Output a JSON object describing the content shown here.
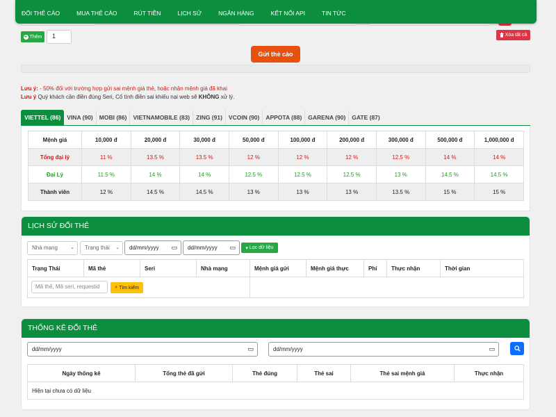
{
  "nav": {
    "items": [
      "ĐỔI THẺ CÀO",
      "MUA THẺ CÀO",
      "RÚT TIỀN",
      "LỊCH SỬ",
      "NGÂN HÀNG",
      "KẾT NỐI API",
      "TIN TỨC"
    ]
  },
  "form": {
    "add_label": "Thêm",
    "quantity": "1",
    "clear_label": "Xóa tất cả",
    "submit_label": "Gửi thẻ cào"
  },
  "notes": {
    "label": "Lưu ý:",
    "line1": "- 50% đối với trường hợp gửi sai mệnh giá thẻ, hoặc nhận mệnh giá đã khai",
    "line2_label": "Lưu ý",
    "line2_text": "Quý khách cần điền đúng Seri, Cố tình điền sai khiếu nại web sẽ",
    "line2_bold": "KHÔNG",
    "line2_end": "xử lý."
  },
  "telco_tabs": [
    "VIETTEL (86)",
    "VINA (90)",
    "MOBI (86)",
    "VIETNAMOBILE (83)",
    "ZING (91)",
    "VCOIN (90)",
    "APPOTA (88)",
    "GARENA (90)",
    "GATE (87)"
  ],
  "rate_table": {
    "header_label": "Mệnh giá",
    "denominations": [
      "10,000 đ",
      "20,000 đ",
      "30,000 đ",
      "50,000 đ",
      "100,000 đ",
      "200,000 đ",
      "300,000 đ",
      "500,000 đ",
      "1,000,000 đ"
    ],
    "rows": [
      {
        "label": "Tổng đại lý",
        "values": [
          "11 %",
          "13.5 %",
          "13.5 %",
          "12 %",
          "12 %",
          "12 %",
          "12.5 %",
          "14 %",
          "14 %"
        ]
      },
      {
        "label": "Đại Lý",
        "values": [
          "11.5 %",
          "14 %",
          "14 %",
          "12.5 %",
          "12.5 %",
          "12.5 %",
          "13 %",
          "14.5 %",
          "14.5 %"
        ]
      },
      {
        "label": "Thành viên",
        "values": [
          "12 %",
          "14.5 %",
          "14.5 %",
          "13 %",
          "13 %",
          "13 %",
          "13.5 %",
          "15 %",
          "15 %"
        ]
      }
    ],
    "colors": {
      "agent_general": "#cc1a1a",
      "agent": "#1aa31a"
    }
  },
  "history": {
    "title": "LỊCH SỬ ĐỔI THẺ",
    "network_select": "Nhà mạng",
    "status_select": "Trạng thái",
    "date_from": "dd/mm/yyyy",
    "date_to": "dd/mm/yyyy",
    "filter_label": "Lọc dữ liệu",
    "columns": [
      "Trạng Thái",
      "Mã thẻ",
      "Seri",
      "Nhà mạng",
      "Mệnh giá gửi",
      "Mệnh giá thực",
      "Phí",
      "Thực nhận",
      "Thời gian"
    ],
    "search_placeholder": "Mã thẻ, Mã seri, requestid",
    "search_label": "Tìm kiếm"
  },
  "stats": {
    "title": "THỐNG KÊ ĐỔI THẺ",
    "date_from": "dd/mm/yyyy",
    "date_to": "dd/mm/yyyy",
    "columns": [
      "Ngày thống kê",
      "Tổng thẻ đã gửi",
      "Thẻ đúng",
      "Thẻ sai",
      "Thẻ sai mệnh giá",
      "Thực nhận"
    ],
    "empty_text": "Hiện tại chưa có dữ liệu"
  },
  "theme": {
    "brand": "#0b8f3e",
    "submit": "#e8500e",
    "danger": "#dc3545",
    "warning": "#ffc107",
    "primary": "#0d6efd"
  },
  "icons": [
    "plus-circle-icon",
    "trash-icon",
    "filter-icon",
    "search-icon",
    "calendar-icon"
  ]
}
